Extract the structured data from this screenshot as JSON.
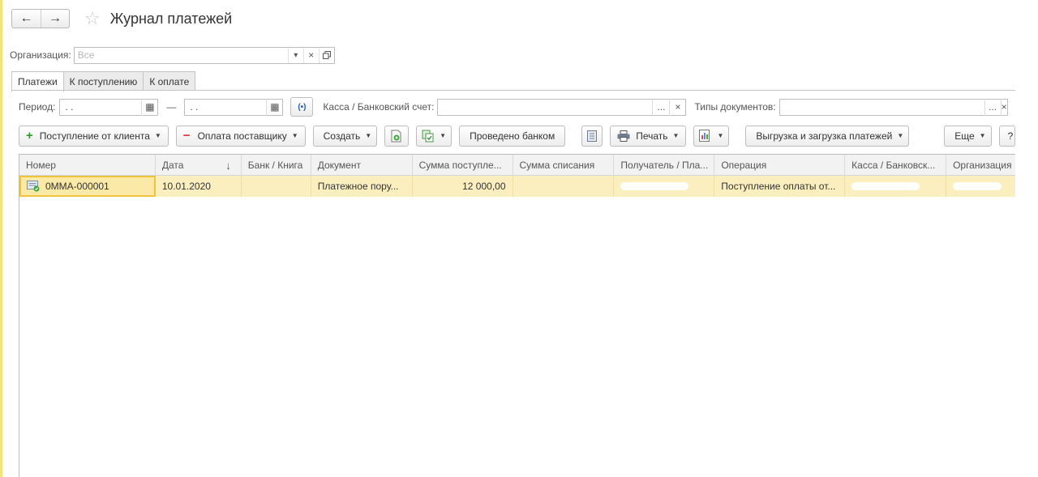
{
  "nav": {
    "back": "←",
    "forward": "→"
  },
  "title": "Журнал платежей",
  "org": {
    "label": "Организация:",
    "placeholder": "Все"
  },
  "tabs": [
    "Платежи",
    "К поступлению",
    "К оплате"
  ],
  "filters": {
    "period_label": "Период:",
    "date_from": " .  .",
    "dash": "—",
    "date_to": " .  .",
    "kassa_label": "Касса / Банковский счет:",
    "types_label": "Типы документов:",
    "dots": "...",
    "clear": "×"
  },
  "toolbar": {
    "receipt": "Поступление от клиента",
    "payment": "Оплата поставщику",
    "create": "Создать",
    "bank_done": "Проведено банком",
    "print": "Печать",
    "exchange": "Выгрузка и загрузка платежей",
    "more": "Еще",
    "help": "?"
  },
  "table": {
    "columns": [
      "Номер",
      "Дата",
      "Банк / Книга",
      "Документ",
      "Сумма поступле...",
      "Сумма списания",
      "Получатель / Пла...",
      "Операция",
      "Касса / Банковск...",
      "Организация"
    ],
    "sort_indicator": "↓",
    "rows": [
      {
        "number": "0ММА-000001",
        "date": "10.01.2020",
        "bank": "",
        "document": "Платежное пору...",
        "income": "12 000,00",
        "expense": "",
        "recipient": "",
        "operation": "Поступление оплаты от...",
        "kassa": "",
        "org": ""
      }
    ]
  },
  "colors": {
    "selected_row": "#fbefc0",
    "selected_cell_border": "#f0c33c",
    "accent_strip": "#f2e27a"
  }
}
